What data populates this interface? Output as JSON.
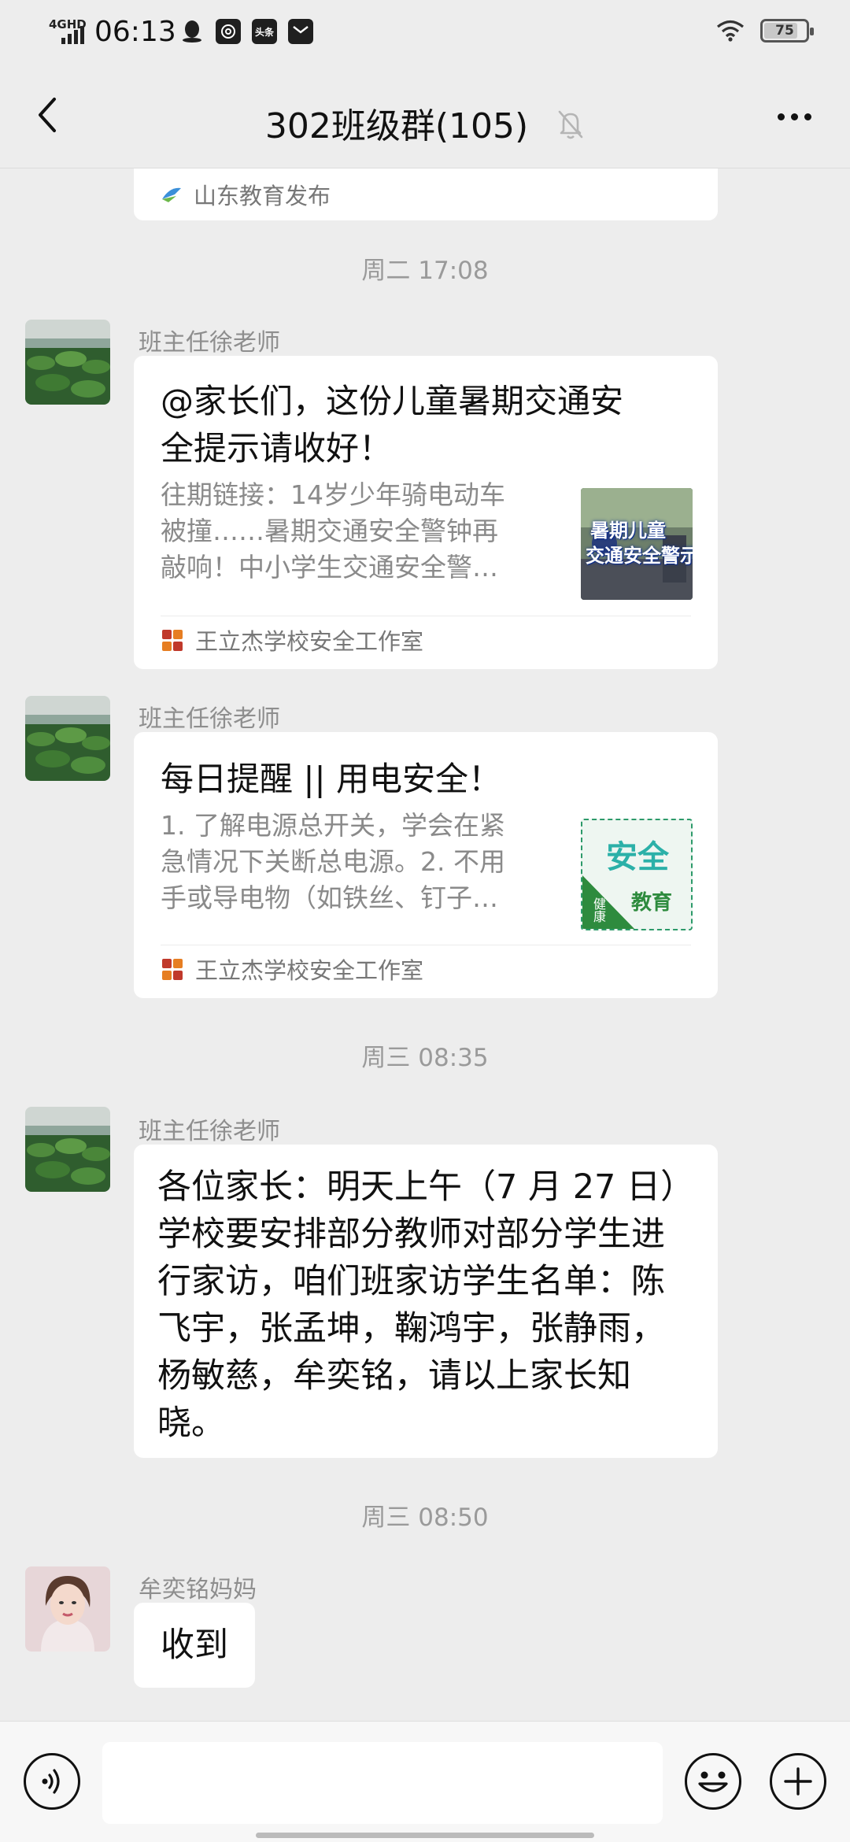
{
  "status_bar": {
    "network": "4GHD",
    "time": "06:13",
    "app_icons": [
      "qq-penguin-icon",
      "at-icon",
      "toutiao-icon",
      "mail-icon"
    ],
    "toutiao_label": "头条",
    "battery": "75",
    "battery_level": 0.75
  },
  "header": {
    "title": "302班级群(105)",
    "muted": true
  },
  "messages": [
    {
      "type": "card-partial",
      "source": "山东教育发布"
    },
    {
      "type": "time",
      "text": "周二 17:08"
    },
    {
      "type": "card",
      "sender": "班主任徐老师",
      "title": "@家长们，这份儿童暑期交通安全提示请收好！",
      "title_lines": [
        "@家长们，这份儿童暑期交通安",
        "全提示请收好！"
      ],
      "desc_lines": [
        "往期链接：14岁少年骑电动车",
        "被撞……暑期交通安全警钟再",
        "敲响！中小学生交通安全警…"
      ],
      "thumb_text_1": "暑期儿童",
      "thumb_text_2": "交通安全警示",
      "source": "王立杰学校安全工作室"
    },
    {
      "type": "card",
      "sender": "班主任徐老师",
      "title": "每日提醒 || 用电安全！",
      "desc_lines": [
        "1. 了解电源总开关，学会在紧",
        "急情况下关断总电源。2. 不用",
        "手或导电物（如铁丝、钉子…"
      ],
      "thumb_text_1": "安全",
      "thumb_text_2": "健康",
      "thumb_text_3": "教育",
      "source": "王立杰学校安全工作室"
    },
    {
      "type": "time",
      "text": "周三 08:35"
    },
    {
      "type": "text",
      "sender": "班主任徐老师",
      "lines": [
        "各位家长：明天上午（7 月 27 日）",
        "学校要安排部分教师对部分学生进",
        "行家访，咱们班家访学生名单：陈",
        "飞宇，张孟坤，鞠鸿宇，张静雨，",
        "杨敏慈，牟奕铭，请以上家长知",
        "晓。"
      ]
    },
    {
      "type": "time",
      "text": "周三 08:50"
    },
    {
      "type": "text",
      "sender": "牟奕铭妈妈",
      "lines": [
        "收到"
      ]
    }
  ],
  "input_bar": {
    "value": ""
  },
  "icons": {
    "back": "back-arrow-icon",
    "mute": "bell-muted-icon",
    "more": "more-icon",
    "voice": "voice-icon",
    "emoji": "emoji-icon",
    "plus": "plus-icon"
  }
}
